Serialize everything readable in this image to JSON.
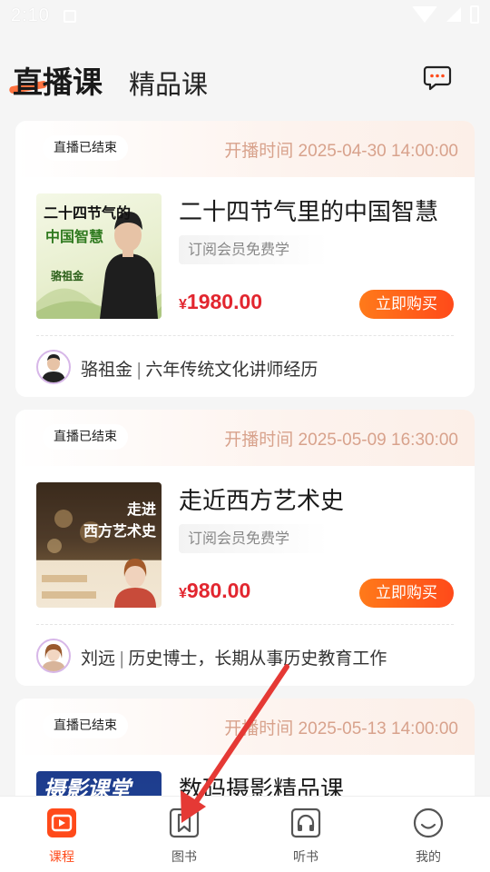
{
  "status_bar": {
    "time": "2:10"
  },
  "header": {
    "tabs": [
      {
        "label": "直播课",
        "active": true
      },
      {
        "label": "精品课",
        "active": false
      }
    ],
    "message_icon": "chat-bubble-icon"
  },
  "courses": [
    {
      "status": "直播已结束",
      "start_time": "开播时间 2025-04-30 14:00:00",
      "thumb_text": [
        "二十四节气的",
        "中国智慧",
        "骆祖金"
      ],
      "title": "二十四节气里的中国智慧",
      "tag": "订阅会员免费学",
      "currency": "¥",
      "price": "1980.00",
      "buy_label": "立即购买",
      "teacher_name": "骆祖金",
      "teacher_desc": "六年传统文化讲师经历"
    },
    {
      "status": "直播已结束",
      "start_time": "开播时间 2025-05-09 16:30:00",
      "thumb_text": [
        "走进",
        "西方艺术史"
      ],
      "title": "走近西方艺术史",
      "tag": "订阅会员免费学",
      "currency": "¥",
      "price": "980.00",
      "buy_label": "立即购买",
      "teacher_name": "刘远",
      "teacher_desc": "历史博士，长期从事历史教育工作"
    },
    {
      "status": "直播已结束",
      "start_time": "开播时间 2025-05-13 14:00:00",
      "thumb_text": [
        "摄影课堂"
      ],
      "title": "数码摄影精品课"
    }
  ],
  "bottom_nav": [
    {
      "label": "课程",
      "icon": "play-icon",
      "active": true
    },
    {
      "label": "图书",
      "icon": "book-icon",
      "active": false
    },
    {
      "label": "听书",
      "icon": "headphones-icon",
      "active": false
    },
    {
      "label": "我的",
      "icon": "smile-icon",
      "active": false
    }
  ],
  "colors": {
    "accent": "#ff4a1a",
    "price": "#e2262f",
    "time": "#d8a28c",
    "annotation_arrow": "#e53935"
  }
}
